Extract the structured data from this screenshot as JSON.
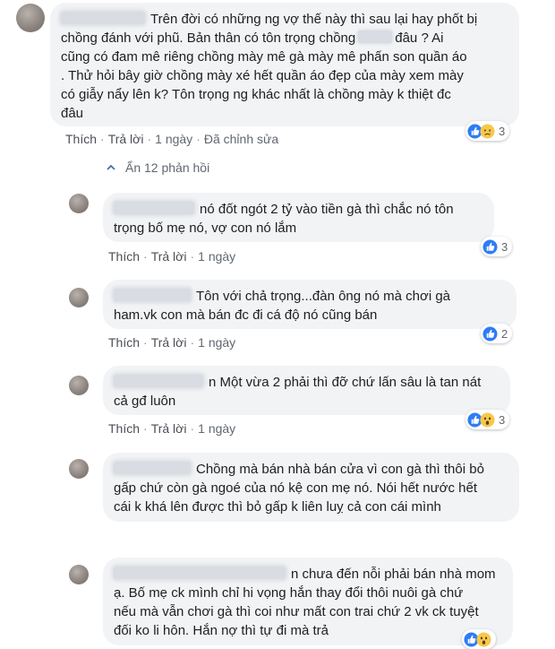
{
  "top_comment": {
    "lines": [
      "Trên đời có những ng vợ thế này thì sau lại hay phốt bị",
      "chồng đánh với phũ. Bản thân có tôn trọng chồng",
      "đâu ? Ai",
      "cũng có đam mê riêng chồng mày mê gà mày mê phấn son quần áo",
      ". Thử hỏi bây giờ chồng mày xé hết quần áo đẹp của mày xem mày",
      "có giẫy nẩy lên k? Tôn trọng ng khác nhất là chồng mày k thiệt đc",
      "đâu"
    ],
    "like": "Thích",
    "reply": "Trả lời",
    "time": "1 ngày",
    "edited": "Đã chỉnh sửa",
    "reaction_count": "3",
    "reaction_icons": [
      "like-icon",
      "sad-icon"
    ]
  },
  "hidden_replies_label": "Ẩn 12 phản hồi",
  "replies": [
    {
      "lines": [
        "nó đốt ngót 2 tỷ vào tiền gà thì chắc nó tôn",
        "trọng bố mẹ nó, vợ con nó lắm"
      ],
      "like": "Thích",
      "reply": "Trả lời",
      "time": "1 ngày",
      "reaction_count": "3",
      "reaction_icons": [
        "like-icon"
      ]
    },
    {
      "lines": [
        "Tôn với chả trọng...đàn ông nó mà chơi gà",
        "ham.vk con mà bán đc đi cá độ nó cũng bán"
      ],
      "like": "Thích",
      "reply": "Trả lời",
      "time": "1 ngày",
      "reaction_count": "2",
      "reaction_icons": [
        "like-icon"
      ]
    },
    {
      "lines": [
        "n Một vừa 2 phải thì đỡ chứ lấn sâu là tan nát",
        "cả gđ luôn"
      ],
      "like": "Thích",
      "reply": "Trả lời",
      "time": "1 ngày",
      "reaction_count": "3",
      "reaction_icons": [
        "like-icon",
        "wow-icon"
      ]
    },
    {
      "lines": [
        "Chồng mà bán nhà bán cửa vì con gà thì thôi bỏ",
        "gấp chứ còn gà ngoé của nó kệ con mẹ nó. Nói hết nước hết",
        "cái k khá lên được thì bỏ gấp k liên luỵ cả con cái mình"
      ]
    },
    {
      "lines": [
        "n chưa đến nỗi phải bán nhà mom",
        "ạ. Bố mẹ ck mình chỉ hi vọng hắn thay đổi thôi nuôi gà chứ",
        "nếu mà vẫn chơi gà thì coi như mất con trai chứ 2 vk ck tuyệt",
        "đối ko li hôn. Hắn nợ thì tự đi mà trả"
      ]
    }
  ],
  "colors": {
    "bubble": "#f2f3f5",
    "link_text": "#4b4f56",
    "meta_text": "#606770",
    "like_blue": "#1877f2",
    "emoji_yellow": "#fcd34d"
  }
}
